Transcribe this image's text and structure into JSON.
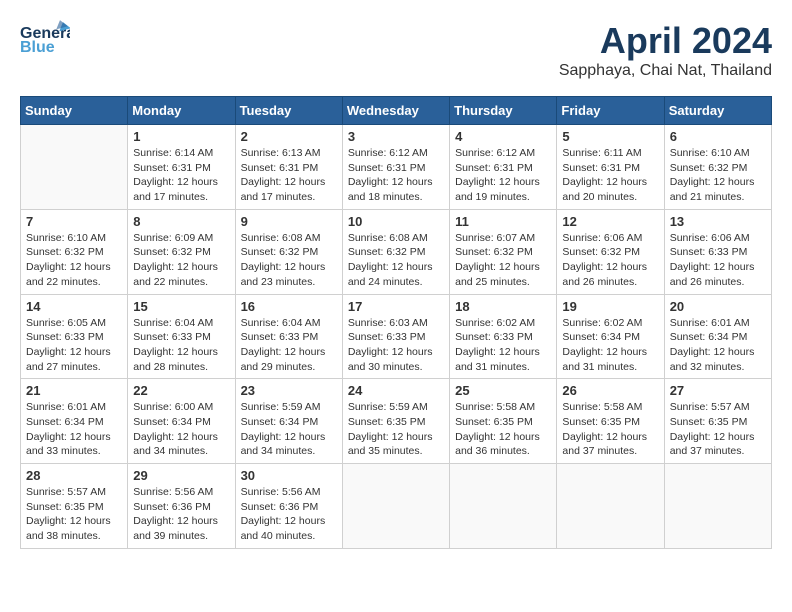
{
  "header": {
    "logo_general": "General",
    "logo_blue": "Blue",
    "month_title": "April 2024",
    "subtitle": "Sapphaya, Chai Nat, Thailand"
  },
  "weekdays": [
    "Sunday",
    "Monday",
    "Tuesday",
    "Wednesday",
    "Thursday",
    "Friday",
    "Saturday"
  ],
  "weeks": [
    [
      {
        "day": "",
        "info": ""
      },
      {
        "day": "1",
        "info": "Sunrise: 6:14 AM\nSunset: 6:31 PM\nDaylight: 12 hours\nand 17 minutes."
      },
      {
        "day": "2",
        "info": "Sunrise: 6:13 AM\nSunset: 6:31 PM\nDaylight: 12 hours\nand 17 minutes."
      },
      {
        "day": "3",
        "info": "Sunrise: 6:12 AM\nSunset: 6:31 PM\nDaylight: 12 hours\nand 18 minutes."
      },
      {
        "day": "4",
        "info": "Sunrise: 6:12 AM\nSunset: 6:31 PM\nDaylight: 12 hours\nand 19 minutes."
      },
      {
        "day": "5",
        "info": "Sunrise: 6:11 AM\nSunset: 6:31 PM\nDaylight: 12 hours\nand 20 minutes."
      },
      {
        "day": "6",
        "info": "Sunrise: 6:10 AM\nSunset: 6:32 PM\nDaylight: 12 hours\nand 21 minutes."
      }
    ],
    [
      {
        "day": "7",
        "info": "Sunrise: 6:10 AM\nSunset: 6:32 PM\nDaylight: 12 hours\nand 22 minutes."
      },
      {
        "day": "8",
        "info": "Sunrise: 6:09 AM\nSunset: 6:32 PM\nDaylight: 12 hours\nand 22 minutes."
      },
      {
        "day": "9",
        "info": "Sunrise: 6:08 AM\nSunset: 6:32 PM\nDaylight: 12 hours\nand 23 minutes."
      },
      {
        "day": "10",
        "info": "Sunrise: 6:08 AM\nSunset: 6:32 PM\nDaylight: 12 hours\nand 24 minutes."
      },
      {
        "day": "11",
        "info": "Sunrise: 6:07 AM\nSunset: 6:32 PM\nDaylight: 12 hours\nand 25 minutes."
      },
      {
        "day": "12",
        "info": "Sunrise: 6:06 AM\nSunset: 6:32 PM\nDaylight: 12 hours\nand 26 minutes."
      },
      {
        "day": "13",
        "info": "Sunrise: 6:06 AM\nSunset: 6:33 PM\nDaylight: 12 hours\nand 26 minutes."
      }
    ],
    [
      {
        "day": "14",
        "info": "Sunrise: 6:05 AM\nSunset: 6:33 PM\nDaylight: 12 hours\nand 27 minutes."
      },
      {
        "day": "15",
        "info": "Sunrise: 6:04 AM\nSunset: 6:33 PM\nDaylight: 12 hours\nand 28 minutes."
      },
      {
        "day": "16",
        "info": "Sunrise: 6:04 AM\nSunset: 6:33 PM\nDaylight: 12 hours\nand 29 minutes."
      },
      {
        "day": "17",
        "info": "Sunrise: 6:03 AM\nSunset: 6:33 PM\nDaylight: 12 hours\nand 30 minutes."
      },
      {
        "day": "18",
        "info": "Sunrise: 6:02 AM\nSunset: 6:33 PM\nDaylight: 12 hours\nand 31 minutes."
      },
      {
        "day": "19",
        "info": "Sunrise: 6:02 AM\nSunset: 6:34 PM\nDaylight: 12 hours\nand 31 minutes."
      },
      {
        "day": "20",
        "info": "Sunrise: 6:01 AM\nSunset: 6:34 PM\nDaylight: 12 hours\nand 32 minutes."
      }
    ],
    [
      {
        "day": "21",
        "info": "Sunrise: 6:01 AM\nSunset: 6:34 PM\nDaylight: 12 hours\nand 33 minutes."
      },
      {
        "day": "22",
        "info": "Sunrise: 6:00 AM\nSunset: 6:34 PM\nDaylight: 12 hours\nand 34 minutes."
      },
      {
        "day": "23",
        "info": "Sunrise: 5:59 AM\nSunset: 6:34 PM\nDaylight: 12 hours\nand 34 minutes."
      },
      {
        "day": "24",
        "info": "Sunrise: 5:59 AM\nSunset: 6:35 PM\nDaylight: 12 hours\nand 35 minutes."
      },
      {
        "day": "25",
        "info": "Sunrise: 5:58 AM\nSunset: 6:35 PM\nDaylight: 12 hours\nand 36 minutes."
      },
      {
        "day": "26",
        "info": "Sunrise: 5:58 AM\nSunset: 6:35 PM\nDaylight: 12 hours\nand 37 minutes."
      },
      {
        "day": "27",
        "info": "Sunrise: 5:57 AM\nSunset: 6:35 PM\nDaylight: 12 hours\nand 37 minutes."
      }
    ],
    [
      {
        "day": "28",
        "info": "Sunrise: 5:57 AM\nSunset: 6:35 PM\nDaylight: 12 hours\nand 38 minutes."
      },
      {
        "day": "29",
        "info": "Sunrise: 5:56 AM\nSunset: 6:36 PM\nDaylight: 12 hours\nand 39 minutes."
      },
      {
        "day": "30",
        "info": "Sunrise: 5:56 AM\nSunset: 6:36 PM\nDaylight: 12 hours\nand 40 minutes."
      },
      {
        "day": "",
        "info": ""
      },
      {
        "day": "",
        "info": ""
      },
      {
        "day": "",
        "info": ""
      },
      {
        "day": "",
        "info": ""
      }
    ]
  ]
}
